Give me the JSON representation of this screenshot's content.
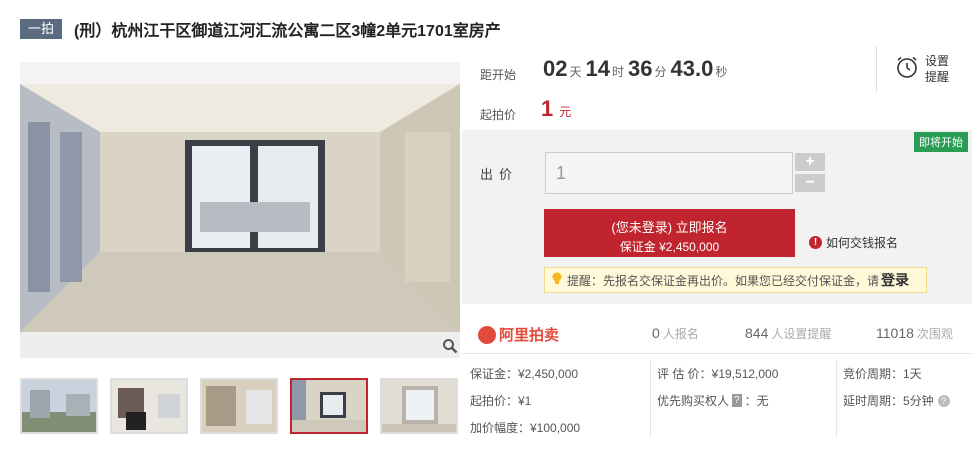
{
  "header": {
    "round_badge": "一拍",
    "title": "(刑）杭州江干区御道江河汇流公寓二区3幢2单元1701室房产"
  },
  "countdown": {
    "label": "距开始",
    "days": "02",
    "days_unit": "天",
    "hours": "14",
    "hours_unit": "时",
    "minutes": "36",
    "minutes_unit": "分",
    "seconds": "43.0",
    "seconds_unit": "秒"
  },
  "reminder": {
    "line1": "设置",
    "line2": "提醒",
    "icon": "alarm-clock-icon"
  },
  "start_price": {
    "label": "起拍价",
    "value": "1",
    "unit": "元"
  },
  "bid": {
    "status_badge": "即将开始",
    "label": "出价",
    "input_value": "1",
    "plus": "+",
    "minus": "−",
    "signup_line1": "(您未登录) 立即报名",
    "signup_line2": "保证金 ¥2,450,000",
    "offline_link": "如何交钱报名",
    "tip_text": "提醒：先报名交保证金再出价。如果您已经交付保证金，请",
    "tip_login": "登录"
  },
  "stats": {
    "platform": "阿里拍卖",
    "signups": "0",
    "signups_label": "人报名",
    "reminders": "844",
    "reminders_label": "人设置提醒",
    "views": "11018",
    "views_label": "次围观"
  },
  "details": {
    "deposit": "保证金：¥2,450,000",
    "start": "起拍价：¥1",
    "increment": "加价幅度：¥100,000",
    "appraisal": "评 估 价：¥19,512,000",
    "priority_prefix": "优先购买权人",
    "priority_tag": "?",
    "priority_value": "：无",
    "cycle": "竞价周期：1天",
    "extension": "延时周期：5分钟"
  },
  "colors": {
    "accent": "#c0242e",
    "badge": "#5a6b80",
    "status_green": "#2a9d54",
    "ali_orange": "#e24b3b"
  }
}
